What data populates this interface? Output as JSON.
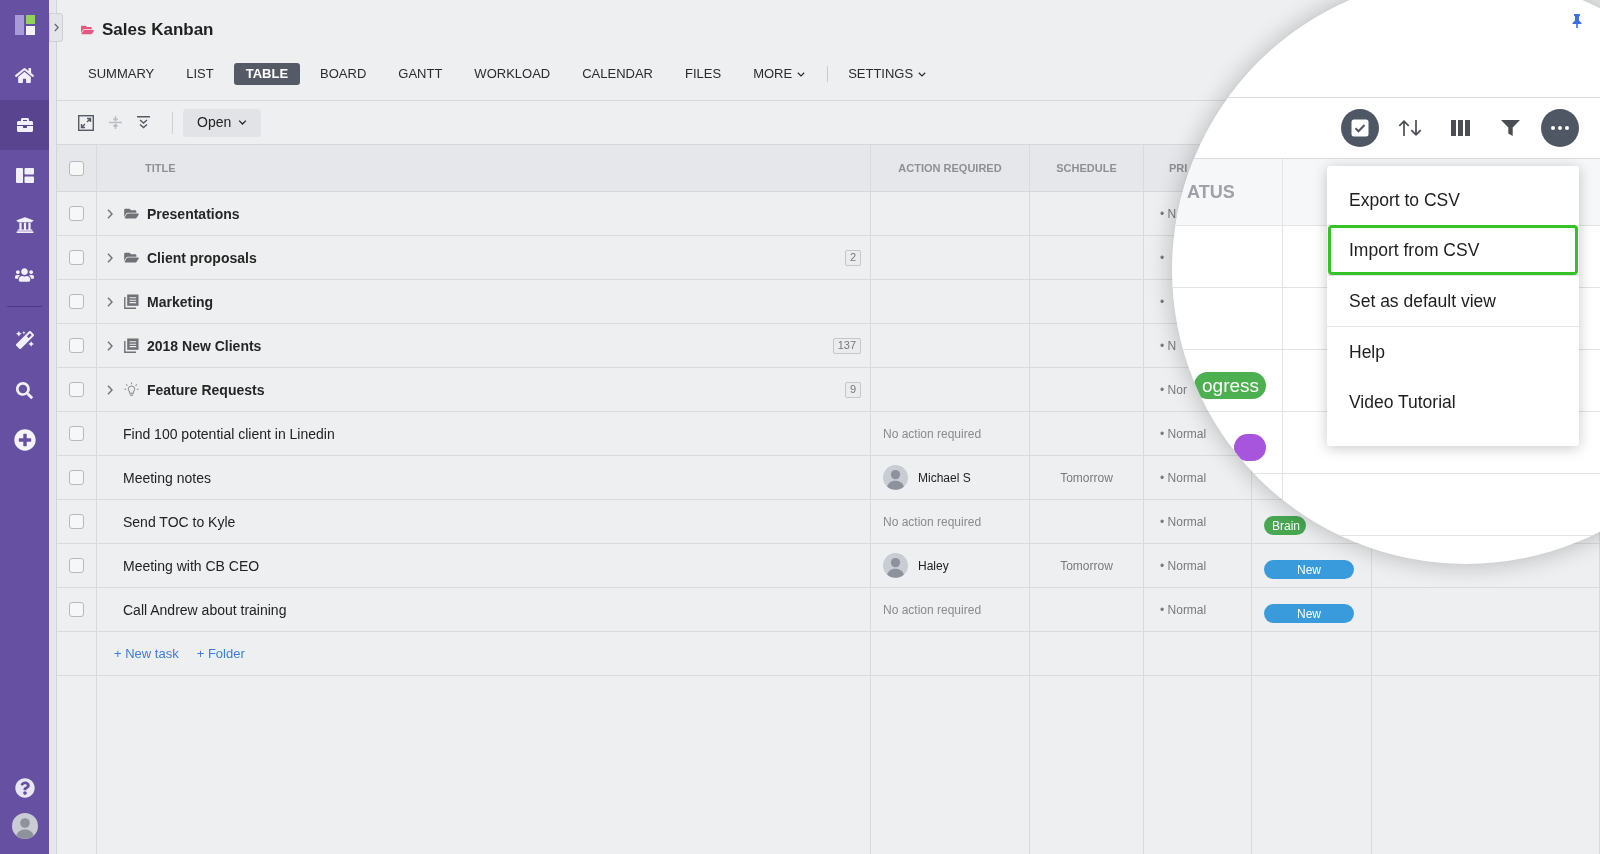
{
  "sidebar": {
    "items": [
      {
        "kind": "home",
        "selected": false
      },
      {
        "kind": "briefcase",
        "selected": true
      },
      {
        "kind": "board",
        "selected": false
      },
      {
        "kind": "bank",
        "selected": false
      },
      {
        "kind": "people",
        "selected": false
      }
    ],
    "tools": [
      {
        "kind": "wand"
      },
      {
        "kind": "search"
      },
      {
        "kind": "add"
      }
    ]
  },
  "project": {
    "title": "Sales Kanban"
  },
  "tabs": [
    {
      "label": "SUMMARY",
      "selected": false,
      "has_menu": false
    },
    {
      "label": "LIST",
      "selected": false,
      "has_menu": false
    },
    {
      "label": "TABLE",
      "selected": true,
      "has_menu": false
    },
    {
      "label": "BOARD",
      "selected": false,
      "has_menu": false
    },
    {
      "label": "GANTT",
      "selected": false,
      "has_menu": false
    },
    {
      "label": "WORKLOAD",
      "selected": false,
      "has_menu": false
    },
    {
      "label": "CALENDAR",
      "selected": false,
      "has_menu": false
    },
    {
      "label": "FILES",
      "selected": false,
      "has_menu": false
    },
    {
      "label": "MORE",
      "selected": false,
      "has_menu": true
    }
  ],
  "settings": {
    "label": "SETTINGS"
  },
  "toolbar": {
    "buttons": [
      {
        "kind": "fullscreen",
        "disabled": false
      },
      {
        "kind": "collapse",
        "disabled": true
      },
      {
        "kind": "expand",
        "disabled": false
      }
    ],
    "filter": {
      "label": "Open"
    }
  },
  "table": {
    "select_all": {
      "checked": false
    },
    "columns": [
      {
        "label": "TITLE"
      },
      {
        "label": "ACTION REQUIRED"
      },
      {
        "label": "SCHEDULE"
      },
      {
        "label": "PRI"
      }
    ],
    "rows": [
      {
        "kind": "folder",
        "title": "Presentations",
        "checked": false,
        "priority": "• N"
      },
      {
        "kind": "folder",
        "title": "Client proposals",
        "count": "2",
        "checked": false,
        "priority": "•"
      },
      {
        "kind": "project",
        "title": "Marketing",
        "checked": false,
        "priority": "•"
      },
      {
        "kind": "project",
        "title": "2018 New Clients",
        "count": "137",
        "checked": false,
        "priority": "• N"
      },
      {
        "kind": "ideas",
        "title": "Feature Requests",
        "count": "9",
        "checked": false,
        "priority": "• Nor"
      },
      {
        "kind": "task",
        "title": "Find 100 potential client in Linedin",
        "checked": false,
        "action": {
          "kind": "note",
          "text": "No action required"
        },
        "priority": "• Normal"
      },
      {
        "kind": "task",
        "title": "Meeting notes",
        "checked": false,
        "action": {
          "kind": "person",
          "name": "Michael S"
        },
        "schedule": "Tomorrow",
        "priority": "• Normal"
      },
      {
        "kind": "task",
        "title": "Send TOC to Kyle",
        "checked": false,
        "action": {
          "kind": "note",
          "text": "No action required"
        },
        "priority": "• Normal",
        "status": {
          "label": "Brain",
          "color": "#48a852",
          "clipped": true
        }
      },
      {
        "kind": "task",
        "title": "Meeting with CB CEO",
        "checked": false,
        "action": {
          "kind": "person",
          "name": "Haley"
        },
        "schedule": "Tomorrow",
        "priority": "• Normal",
        "status": {
          "label": "New",
          "color": "#3a9bdc",
          "clipped": false
        }
      },
      {
        "kind": "task",
        "title": "Call Andrew about training",
        "checked": false,
        "action": {
          "kind": "note",
          "text": "No action required"
        },
        "priority": "• Normal",
        "status": {
          "label": "New",
          "color": "#3a9bdc",
          "clipped": false
        }
      }
    ],
    "add_links": [
      {
        "label": "+ New task"
      },
      {
        "label": "+ Folder"
      }
    ]
  },
  "magnifier": {
    "toolbar": [
      {
        "kind": "select",
        "active": true
      },
      {
        "kind": "sort",
        "active": false
      },
      {
        "kind": "columns",
        "active": false
      },
      {
        "kind": "filter",
        "active": false
      },
      {
        "kind": "more",
        "active": true
      }
    ],
    "column_header": "ATUS",
    "status_pills": [
      {
        "label": "ogress",
        "color": "#4caf50"
      },
      {
        "color": "#a855dd"
      }
    ],
    "menu": {
      "sections": [
        {
          "items": [
            {
              "label": "Export to CSV",
              "highlighted": false
            },
            {
              "label": "Import from CSV",
              "highlighted": true
            }
          ]
        },
        {
          "items": [
            {
              "label": "Set as default view",
              "highlighted": false
            }
          ]
        },
        {
          "items": [
            {
              "label": "Help",
              "highlighted": false
            },
            {
              "label": "Video Tutorial",
              "highlighted": false
            }
          ]
        }
      ]
    }
  }
}
